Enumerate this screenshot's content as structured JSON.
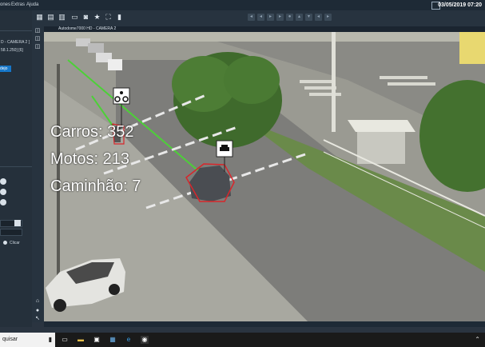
{
  "menu": {
    "items": [
      "ones",
      "Extras",
      "Ajuda"
    ]
  },
  "header": {
    "datetime": "03/05/2019 07:20"
  },
  "left_panel": {
    "lines": [
      "D - CAMERA 2 ]",
      "58.1.250] [6]"
    ],
    "selected": "dejo",
    "record_label": "Clicar"
  },
  "camera": {
    "title": "Autodome7000 HD - CAMERA 2"
  },
  "overlay": {
    "cars": "Carros: 352",
    "motos": "Motos: 213",
    "trucks": "Caminhão: 7"
  },
  "taskbar": {
    "search_placeholder": "quisar"
  },
  "colors": {
    "accent": "#1677c9",
    "detect_line": "#e8e8e8",
    "track": "#4cd137",
    "vehicle_box": "#d8262b"
  }
}
